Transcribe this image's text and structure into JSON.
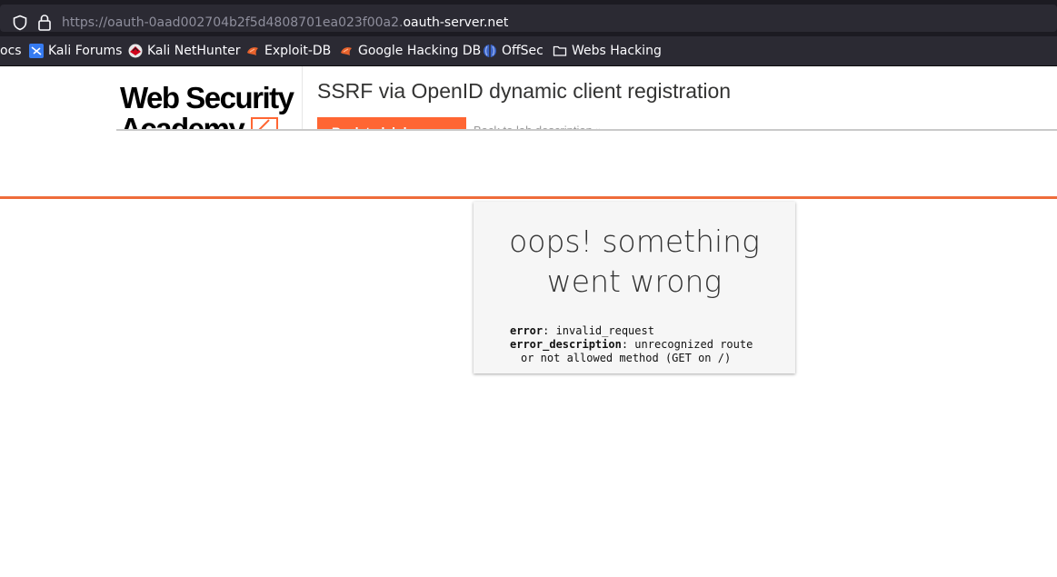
{
  "browser": {
    "url_prefix": "https://oauth-0aad002704b2f5d4808701ea023f00a2.",
    "url_host": "oauth-server.net",
    "bookmarks": [
      {
        "label": "ocs",
        "icon": "docs-icon"
      },
      {
        "label": "Kali Forums",
        "icon": "kali-forums-icon"
      },
      {
        "label": "Kali NetHunter",
        "icon": "kali-nethunter-icon"
      },
      {
        "label": "Exploit-DB",
        "icon": "exploit-db-icon"
      },
      {
        "label": "Google Hacking DB",
        "icon": "google-hacking-db-icon"
      },
      {
        "label": "OffSec",
        "icon": "offsec-icon"
      },
      {
        "label": "Webs Hacking",
        "icon": "folder-icon"
      }
    ]
  },
  "banner": {
    "logo_line1": "Web Security",
    "logo_line2": "Academy",
    "lab_title": "SSRF via OpenID dynamic client registration",
    "back_button": "Back to lab home",
    "back_description": "Back to lab description »"
  },
  "error": {
    "heading_line1": "oops! something",
    "heading_line2": "went wrong",
    "error_key": "error",
    "error_value": "invalid_request",
    "description_key": "error_description",
    "description_value_line1": "unrecognized route",
    "description_value_line2": "or not allowed method (GET on /)"
  },
  "colors": {
    "accent_orange": "#ff6633",
    "chrome_dark": "#2b2a33"
  }
}
